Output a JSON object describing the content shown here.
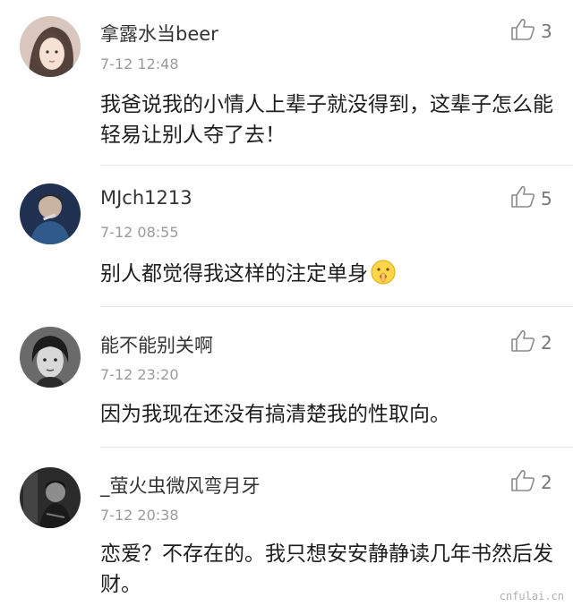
{
  "comments": [
    {
      "username": "拿露水当beer",
      "time": "7-12 12:48",
      "likes": "3",
      "content": "我爸说我的小情人上辈子就没得到，这辈子怎么能轻易让别人夺了去！"
    },
    {
      "username": "MJch1213",
      "time": "7-12 08:55",
      "likes": "5",
      "content": "别人都觉得我这样的注定单身"
    },
    {
      "username": "能不能别关啊",
      "time": "7-12 23:20",
      "likes": "2",
      "content": "因为我现在还没有搞清楚我的性取向。"
    },
    {
      "username": "_萤火虫微风弯月牙",
      "time": "7-12 20:38",
      "likes": "2",
      "content": "恋爱？不存在的。我只想安安静静读几年书然后发财。"
    }
  ],
  "icons": {
    "like": "thumbs-up-icon",
    "emoji": "shushing-face-icon"
  },
  "watermark": "cnfulai.cn"
}
